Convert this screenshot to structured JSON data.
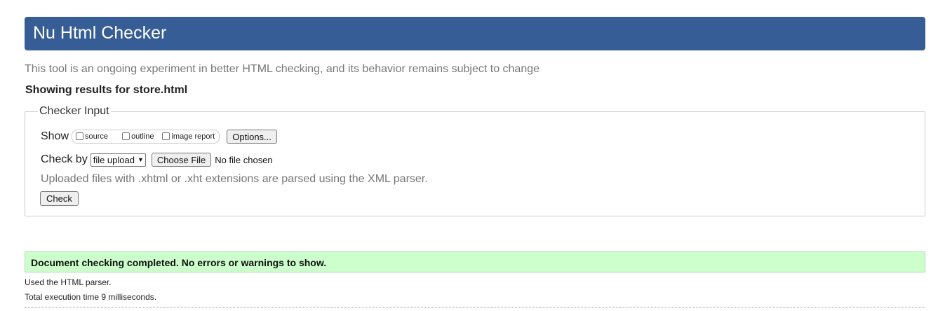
{
  "header": {
    "title": "Nu Html Checker"
  },
  "intro": "This tool is an ongoing experiment in better HTML checking, and its behavior remains subject to change",
  "results_heading": "Showing results for store.html",
  "checker_input": {
    "legend": "Checker Input",
    "show": {
      "label": "Show",
      "options": [
        {
          "label": "source",
          "checked": false
        },
        {
          "label": "outline",
          "checked": false
        },
        {
          "label": "image report",
          "checked": false
        }
      ],
      "options_button": "Options..."
    },
    "check_by": {
      "label": "Check by",
      "selected": "file upload",
      "choose_file_label": "Choose File",
      "file_status": "No file chosen"
    },
    "xml_note": "Uploaded files with .xhtml or .xht extensions are parsed using the XML parser.",
    "check_button": "Check"
  },
  "result": {
    "success_message": "Document checking completed. No errors or warnings to show.",
    "parser_info": "Used the HTML parser.",
    "timing_info": "Total execution time 9 milliseconds."
  },
  "colors": {
    "banner": "#365d95",
    "success_bg": "#ccffcc",
    "muted_text": "#777777"
  }
}
